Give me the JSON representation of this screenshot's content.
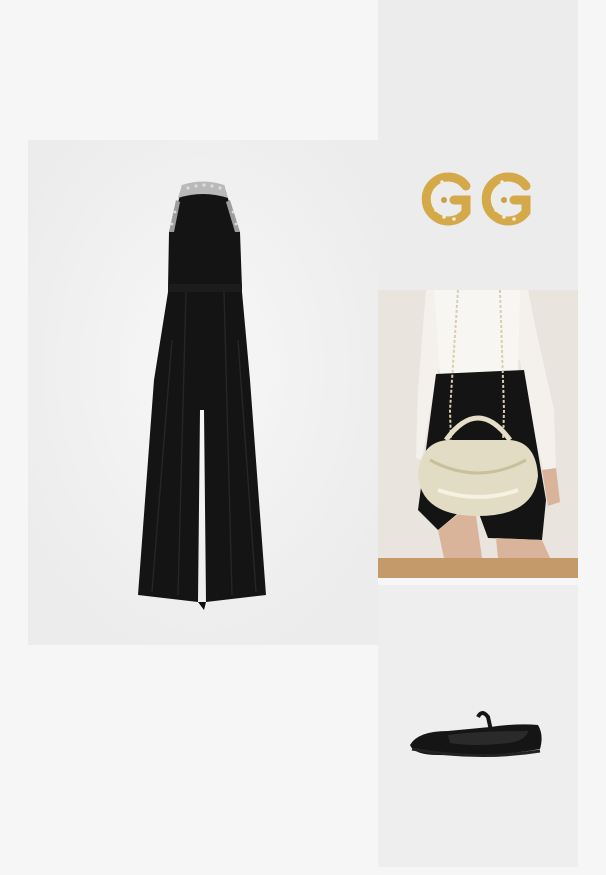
{
  "outfit": {
    "items": [
      {
        "id": "jumpsuit",
        "icon": "jumpsuit-photo",
        "background": "#efefef"
      },
      {
        "id": "earrings",
        "icon": "earrings-photo",
        "background": "#ececec"
      },
      {
        "id": "bag",
        "icon": "shoulder-bag-photo",
        "background": "#e9e4de"
      },
      {
        "id": "flats",
        "icon": "ballet-flats-photo",
        "background": "#eeeeee"
      }
    ]
  },
  "colors": {
    "page_background": "#f6f6f6",
    "garment_black": "#141414",
    "embellishment_silver": "#b9b9b9",
    "gold": "#d4a94a",
    "bag_gold": "#e3dcc4",
    "floor_wood": "#c59a6a"
  }
}
